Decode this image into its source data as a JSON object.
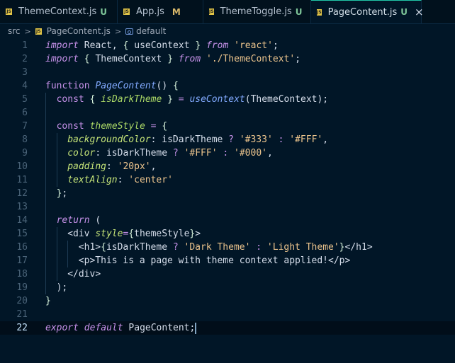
{
  "tabs": [
    {
      "name": "ThemeContext.js",
      "badge": "U",
      "icon": "js-file-icon"
    },
    {
      "name": "App.js",
      "badge": "M",
      "icon": "js-file-icon"
    },
    {
      "name": "ThemeToggle.js",
      "badge": "U",
      "icon": "js-file-icon"
    },
    {
      "name": "PageContent.js",
      "badge": "U",
      "icon": "js-file-icon",
      "active": true,
      "close": "×"
    }
  ],
  "file_icon_text": "JS",
  "breadcrumb": {
    "folder": "src",
    "file": "PageContent.js",
    "symbol": "default",
    "sep": ">"
  },
  "cursor_line": 22,
  "code": [
    {
      "n": 1,
      "indent": 0,
      "toks": [
        [
          "kw",
          "import"
        ],
        [
          "var",
          " React, "
        ],
        [
          "brace",
          "{"
        ],
        [
          "var",
          " useContext "
        ],
        [
          "brace",
          "}"
        ],
        [
          "var",
          " "
        ],
        [
          "kw",
          "from"
        ],
        [
          "var",
          " "
        ],
        [
          "str",
          "'react'"
        ],
        [
          "punc",
          ";"
        ]
      ]
    },
    {
      "n": 2,
      "indent": 0,
      "toks": [
        [
          "kw",
          "import"
        ],
        [
          "var",
          " "
        ],
        [
          "brace",
          "{"
        ],
        [
          "var",
          " ThemeContext "
        ],
        [
          "brace",
          "}"
        ],
        [
          "var",
          " "
        ],
        [
          "kw",
          "from"
        ],
        [
          "var",
          " "
        ],
        [
          "str",
          "'./ThemeContext'"
        ],
        [
          "punc",
          ";"
        ]
      ]
    },
    {
      "n": 3,
      "indent": 0,
      "toks": []
    },
    {
      "n": 4,
      "indent": 0,
      "toks": [
        [
          "kn",
          "function"
        ],
        [
          "var",
          " "
        ],
        [
          "fn",
          "PageContent"
        ],
        [
          "punc",
          "() "
        ],
        [
          "brace",
          "{"
        ]
      ]
    },
    {
      "n": 5,
      "indent": 1,
      "toks": [
        [
          "kn",
          "const"
        ],
        [
          "var",
          " "
        ],
        [
          "brace",
          "{"
        ],
        [
          "var",
          " "
        ],
        [
          "var2",
          "isDarkTheme"
        ],
        [
          "var",
          " "
        ],
        [
          "brace",
          "}"
        ],
        [
          "var",
          " "
        ],
        [
          "op",
          "="
        ],
        [
          "var",
          " "
        ],
        [
          "fn",
          "useContext"
        ],
        [
          "punc",
          "("
        ],
        [
          "var",
          "ThemeContext"
        ],
        [
          "punc",
          ");"
        ]
      ]
    },
    {
      "n": 6,
      "indent": 1,
      "toks": []
    },
    {
      "n": 7,
      "indent": 1,
      "toks": [
        [
          "kn",
          "const"
        ],
        [
          "var",
          " "
        ],
        [
          "var2",
          "themeStyle"
        ],
        [
          "var",
          " "
        ],
        [
          "op",
          "="
        ],
        [
          "var",
          " "
        ],
        [
          "brace",
          "{"
        ]
      ]
    },
    {
      "n": 8,
      "indent": 2,
      "toks": [
        [
          "prop",
          "backgroundColor"
        ],
        [
          "punc",
          ": "
        ],
        [
          "var",
          "isDarkTheme "
        ],
        [
          "op",
          "?"
        ],
        [
          "var",
          " "
        ],
        [
          "str",
          "'#333'"
        ],
        [
          "var",
          " "
        ],
        [
          "op",
          ":"
        ],
        [
          "var",
          " "
        ],
        [
          "str",
          "'#FFF'"
        ],
        [
          "punc",
          ","
        ]
      ]
    },
    {
      "n": 9,
      "indent": 2,
      "toks": [
        [
          "prop",
          "color"
        ],
        [
          "punc",
          ": "
        ],
        [
          "var",
          "isDarkTheme "
        ],
        [
          "op",
          "?"
        ],
        [
          "var",
          " "
        ],
        [
          "str",
          "'#FFF'"
        ],
        [
          "var",
          " "
        ],
        [
          "op",
          ":"
        ],
        [
          "var",
          " "
        ],
        [
          "str",
          "'#000'"
        ],
        [
          "punc",
          ","
        ]
      ]
    },
    {
      "n": 10,
      "indent": 2,
      "toks": [
        [
          "prop",
          "padding"
        ],
        [
          "punc",
          ": "
        ],
        [
          "str",
          "'20px'"
        ],
        [
          "punc",
          ","
        ]
      ]
    },
    {
      "n": 11,
      "indent": 2,
      "toks": [
        [
          "prop",
          "textAlign"
        ],
        [
          "punc",
          ": "
        ],
        [
          "str",
          "'center'"
        ]
      ]
    },
    {
      "n": 12,
      "indent": 1,
      "toks": [
        [
          "brace",
          "}"
        ],
        [
          "punc",
          ";"
        ]
      ]
    },
    {
      "n": 13,
      "indent": 1,
      "toks": []
    },
    {
      "n": 14,
      "indent": 1,
      "toks": [
        [
          "kw",
          "return"
        ],
        [
          "var",
          " "
        ],
        [
          "punc",
          "("
        ]
      ]
    },
    {
      "n": 15,
      "indent": 2,
      "toks": [
        [
          "punc",
          "<"
        ],
        [
          "var",
          "div"
        ],
        [
          "var",
          " "
        ],
        [
          "attr",
          "style"
        ],
        [
          "op",
          "="
        ],
        [
          "brace",
          "{"
        ],
        [
          "var",
          "themeStyle"
        ],
        [
          "brace",
          "}"
        ],
        [
          "punc",
          ">"
        ]
      ]
    },
    {
      "n": 16,
      "indent": 3,
      "toks": [
        [
          "punc",
          "<"
        ],
        [
          "var",
          "h1"
        ],
        [
          "punc",
          ">"
        ],
        [
          "brace",
          "{"
        ],
        [
          "var",
          "isDarkTheme "
        ],
        [
          "op",
          "?"
        ],
        [
          "var",
          " "
        ],
        [
          "str",
          "'Dark Theme'"
        ],
        [
          "var",
          " "
        ],
        [
          "op",
          ":"
        ],
        [
          "var",
          " "
        ],
        [
          "str",
          "'Light Theme'"
        ],
        [
          "brace",
          "}"
        ],
        [
          "punc",
          "</"
        ],
        [
          "var",
          "h1"
        ],
        [
          "punc",
          ">"
        ]
      ]
    },
    {
      "n": 17,
      "indent": 3,
      "toks": [
        [
          "punc",
          "<"
        ],
        [
          "var",
          "p"
        ],
        [
          "punc",
          ">"
        ],
        [
          "var",
          "This is a page with theme context applied!"
        ],
        [
          "punc",
          "</"
        ],
        [
          "var",
          "p"
        ],
        [
          "punc",
          ">"
        ]
      ]
    },
    {
      "n": 18,
      "indent": 2,
      "toks": [
        [
          "punc",
          "</"
        ],
        [
          "var",
          "div"
        ],
        [
          "punc",
          ">"
        ]
      ]
    },
    {
      "n": 19,
      "indent": 1,
      "toks": [
        [
          "punc",
          ");"
        ]
      ]
    },
    {
      "n": 20,
      "indent": 0,
      "toks": [
        [
          "brace",
          "}"
        ]
      ]
    },
    {
      "n": 21,
      "indent": 0,
      "toks": []
    },
    {
      "n": 22,
      "indent": 0,
      "toks": [
        [
          "kw",
          "export"
        ],
        [
          "var",
          " "
        ],
        [
          "kw",
          "default"
        ],
        [
          "var",
          " PageContent;"
        ]
      ]
    }
  ],
  "colors": {
    "background": "#011627",
    "accent": "#21c7a8",
    "untracked": "#7ec699",
    "modified": "#d9b86a"
  }
}
